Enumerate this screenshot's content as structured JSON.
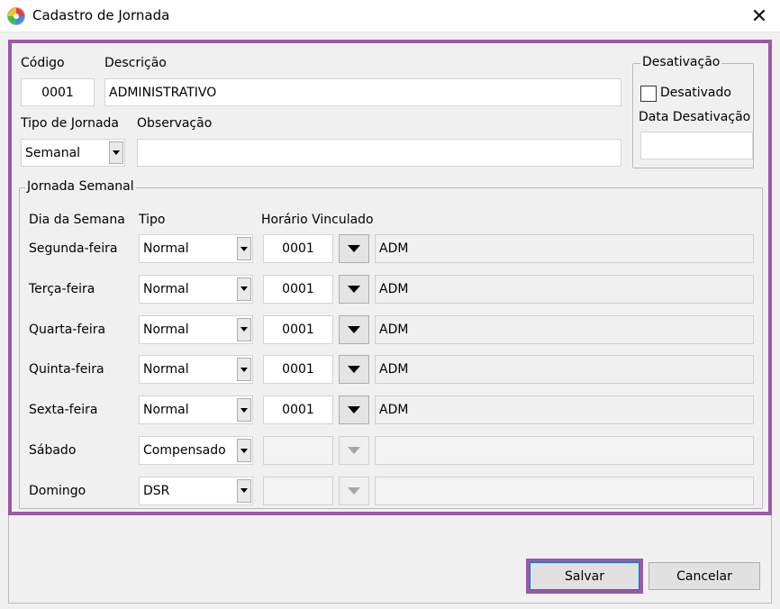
{
  "window": {
    "title": "Cadastro de Jornada",
    "close_glyph": "✕",
    "icon": "app-logo-icon"
  },
  "header": {
    "codigo_label": "Código",
    "codigo_value": "0001",
    "descricao_label": "Descrição",
    "descricao_value": "ADMINISTRATIVO",
    "tipo_jornada_label": "Tipo de Jornada",
    "tipo_jornada_value": "Semanal",
    "observacao_label": "Observação",
    "observacao_value": ""
  },
  "desativacao": {
    "group_title": "Desativação",
    "checkbox_label": "Desativado",
    "checked": false,
    "data_label": "Data Desativação",
    "data_value": ""
  },
  "jornada_semanal": {
    "group_title": "Jornada Semanal",
    "col_dia": "Dia da Semana",
    "col_tipo": "Tipo",
    "col_horario": "Horário Vinculado",
    "rows": [
      {
        "dia": "Segunda-feira",
        "tipo": "Normal",
        "horario": "0001",
        "desc": "ADM"
      },
      {
        "dia": "Terça-feira",
        "tipo": "Normal",
        "horario": "0001",
        "desc": "ADM"
      },
      {
        "dia": "Quarta-feira",
        "tipo": "Normal",
        "horario": "0001",
        "desc": "ADM"
      },
      {
        "dia": "Quinta-feira",
        "tipo": "Normal",
        "horario": "0001",
        "desc": "ADM"
      },
      {
        "dia": "Sexta-feira",
        "tipo": "Normal",
        "horario": "0001",
        "desc": "ADM"
      },
      {
        "dia": "Sábado",
        "tipo": "Compensado",
        "horario": "",
        "desc": ""
      },
      {
        "dia": "Domingo",
        "tipo": "DSR",
        "horario": "",
        "desc": ""
      }
    ]
  },
  "buttons": {
    "salvar": "Salvar",
    "cancelar": "Cancelar"
  },
  "colors": {
    "highlight": "#9b59a8",
    "window_bg": "#f0f0f0"
  }
}
